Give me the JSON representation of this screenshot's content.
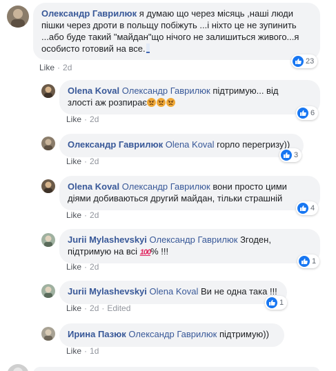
{
  "comments": [
    {
      "author": "Олександр Гаврилюк",
      "mention": "",
      "line1": "я думаю що через місяць ,наші люди",
      "line2": "пішки через дроти в польщу побіжуть ...і ніхто це не зупинить",
      "line3": "...або буде такий \"майдан\"що нічого не залишиться живого...я",
      "line4": "особисто готовий на все.",
      "like": "Like",
      "time": "2d",
      "edited": "",
      "reactions": "23"
    },
    {
      "author": "Olena Koval",
      "mention": "Олександр Гаврилюк",
      "line1": "підтримую... від",
      "line2": "злості аж розпирає",
      "like": "Like",
      "time": "2d",
      "edited": "",
      "reactions": "6"
    },
    {
      "author": "Олександр Гаврилюк",
      "mention": "Olena Koval",
      "line1": "горло перегризу))",
      "like": "Like",
      "time": "2d",
      "edited": "",
      "reactions": "3"
    },
    {
      "author": "Olena Koval",
      "mention": "Олександр Гаврилюк",
      "line1": "вони просто цими",
      "line2": "діями добиваються другий майдан, тільки страшній",
      "like": "Like",
      "time": "2d",
      "edited": "",
      "reactions": "4"
    },
    {
      "author": "Jurii Mylashevskyi",
      "mention": "Олександр Гаврилюк",
      "line1": "Згоден,",
      "line2a": "підтримую на всі",
      "emoji": "100",
      "line2b": "% !!!",
      "like": "Like",
      "time": "2d",
      "edited": "",
      "reactions": "1"
    },
    {
      "author": "Jurii Mylashevskyi",
      "mention": "Olena Koval",
      "line1": "Ви не одна така !!!",
      "like": "Like",
      "time": "2d",
      "edited": "Edited",
      "reactions": "1"
    },
    {
      "author": "Ирина Пазюк",
      "mention": "Олександр Гаврилюк",
      "line1": "підтримую))",
      "like": "Like",
      "time": "1d",
      "edited": "",
      "reactions": ""
    }
  ],
  "ui": {
    "separator": "·",
    "edited_separator": "·"
  },
  "colors": {
    "author": "#385898",
    "bubble": "#f2f3f5",
    "like_blue": "#1877f2",
    "meta": "#90949c"
  },
  "icons": {
    "reaction": "thumbs-up-icon",
    "angry": "angry-face-emoji",
    "hundred": "hundred-points-emoji"
  }
}
